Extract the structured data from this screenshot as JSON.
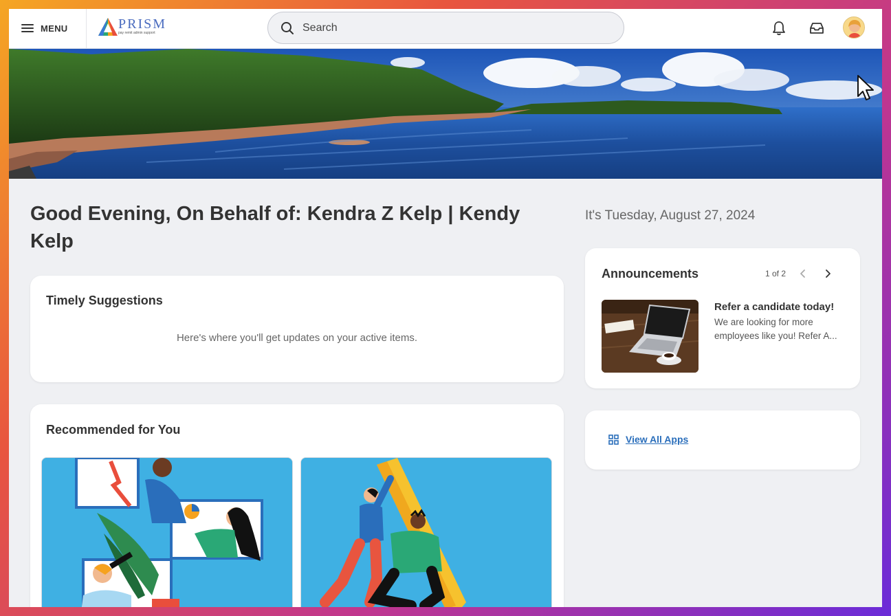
{
  "topbar": {
    "menu_label": "MENU",
    "logo_text": "PRISM",
    "logo_tagline": "pay remit admin support",
    "search_placeholder": "Search"
  },
  "greeting": "Good Evening, On Behalf of: Kendra Z Kelp | Kendy Kelp",
  "date_text": "It's Tuesday, August 27, 2024",
  "timely": {
    "title": "Timely Suggestions",
    "empty_message": "Here's where you'll get updates on your active items."
  },
  "recommended": {
    "title": "Recommended for You"
  },
  "announcements": {
    "title": "Announcements",
    "pager": "1 of 2",
    "item_title": "Refer a candidate today!",
    "item_body_line1": "We are looking for more",
    "item_body_line2": "employees like you! Refer A..."
  },
  "apps": {
    "link_label": "View All Apps"
  },
  "colors": {
    "accent": "#2a6ebb",
    "tile_blue": "#3fb0e3",
    "page_bg": "#eff0f3"
  },
  "icons": [
    "menu-icon",
    "search-icon",
    "bell-icon",
    "inbox-icon",
    "chevron-left-icon",
    "chevron-right-icon",
    "grid-icon",
    "cursor-icon"
  ]
}
